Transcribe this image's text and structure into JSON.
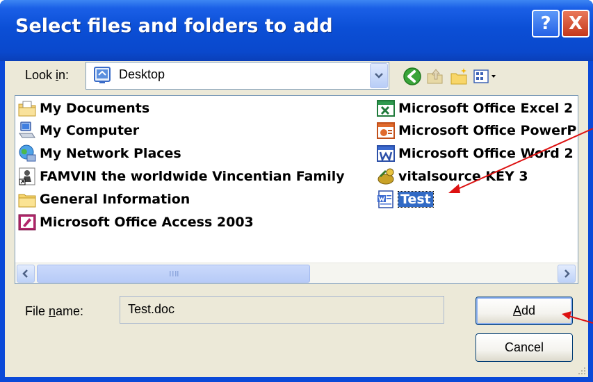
{
  "window": {
    "title": "Select files and folders to add"
  },
  "title_buttons": {
    "help": "?",
    "close": "X"
  },
  "lookin": {
    "label_prefix": "Look ",
    "label_underlined": "i",
    "label_suffix": "n:",
    "value": "Desktop",
    "icon": "desktop-icon"
  },
  "toolbar": {
    "icons": [
      "back-icon",
      "up-folder-icon",
      "new-folder-icon",
      "views-menu-icon"
    ]
  },
  "files": {
    "items": [
      {
        "label": "My Documents",
        "icon": "my-documents-icon"
      },
      {
        "label": "My Computer",
        "icon": "my-computer-icon"
      },
      {
        "label": "My Network Places",
        "icon": "network-places-icon"
      },
      {
        "label": "FAMVIN the worldwide Vincentian Family",
        "icon": "shortcut-icon"
      },
      {
        "label": "General Information",
        "icon": "folder-icon"
      },
      {
        "label": "Microsoft Office Access 2003",
        "icon": "access-icon"
      },
      {
        "label": "Microsoft Office Excel 2",
        "icon": "excel-icon"
      },
      {
        "label": "Microsoft Office PowerP",
        "icon": "powerpoint-icon"
      },
      {
        "label": "Microsoft Office Word 2",
        "icon": "word-icon"
      },
      {
        "label": "vitalsource KEY 3",
        "icon": "vitalsource-icon"
      },
      {
        "label": "Test",
        "icon": "word-doc-icon",
        "selected": true
      }
    ]
  },
  "filename": {
    "label_prefix": "File ",
    "label_underlined": "n",
    "label_suffix": "ame:",
    "value": "Test.doc"
  },
  "buttons": {
    "add_underlined": "A",
    "add_rest": "dd",
    "cancel": "Cancel"
  },
  "colors": {
    "titlebar": "#0b4fd6",
    "dialog_bg": "#ece9d8",
    "selection": "#316ac5",
    "annotation_arrow": "#dd1111"
  }
}
